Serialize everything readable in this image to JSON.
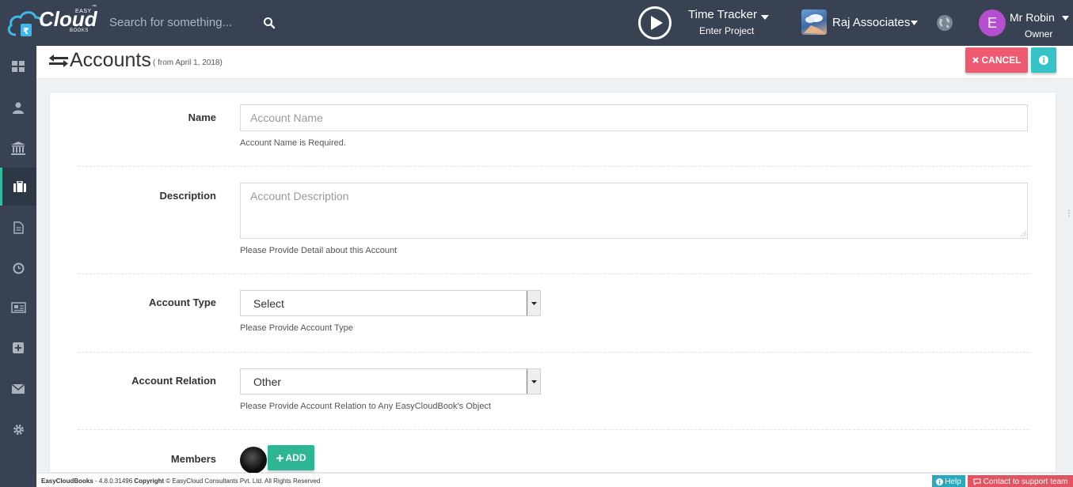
{
  "brand": {
    "easy": "EASY",
    "cloud": "Cloud",
    "books": "BOOKS",
    "tm": "™"
  },
  "search": {
    "placeholder": "Search for something..."
  },
  "time_tracker": {
    "title": "Time Tracker",
    "subtitle": "Enter Project"
  },
  "company": {
    "name": "Raj Associates"
  },
  "user": {
    "initial": "E",
    "name": "Mr Robin",
    "role": "Owner"
  },
  "sidebar": {
    "items": [
      {
        "icon": "dashboard-icon"
      },
      {
        "icon": "user-icon"
      },
      {
        "icon": "bank-icon"
      },
      {
        "icon": "briefcase-icon",
        "active": true
      },
      {
        "icon": "document-icon"
      },
      {
        "icon": "clock-icon"
      },
      {
        "icon": "newspaper-icon"
      },
      {
        "icon": "plus-square-icon"
      },
      {
        "icon": "envelope-icon"
      },
      {
        "icon": "gear-icon"
      }
    ]
  },
  "page": {
    "title": "Accounts",
    "subtitle": "( from April 1, 2018)"
  },
  "actions": {
    "cancel_label": "CANCEL"
  },
  "form": {
    "name": {
      "label": "Name",
      "placeholder": "Account Name",
      "help": "Account Name is Required."
    },
    "description": {
      "label": "Description",
      "placeholder": "Account Description",
      "help": "Please Provide Detail about this Account"
    },
    "account_type": {
      "label": "Account Type",
      "value": "Select",
      "help": "Please Provide Account Type"
    },
    "account_relation": {
      "label": "Account Relation",
      "value": "Other",
      "help": "Please Provide Account Relation to Any EasyCloudBook's Object"
    },
    "members": {
      "label": "Members",
      "add_label": "ADD"
    }
  },
  "footer": {
    "app": "EasyCloudBooks",
    "version": " - 4.8.0.31496 ",
    "copyright_label": "Copyright",
    "copyright_text": " © EasyCloud Consultants Pvt. Ltd. All Rights Reserved",
    "help_label": "Help",
    "support_label": "Contact to support team"
  },
  "colors": {
    "topbar": "#384253",
    "accent_green": "#2db594",
    "cancel_red": "#ee5a6f",
    "info_teal": "#35c3c8",
    "avatar_purple": "#b64fcf"
  }
}
